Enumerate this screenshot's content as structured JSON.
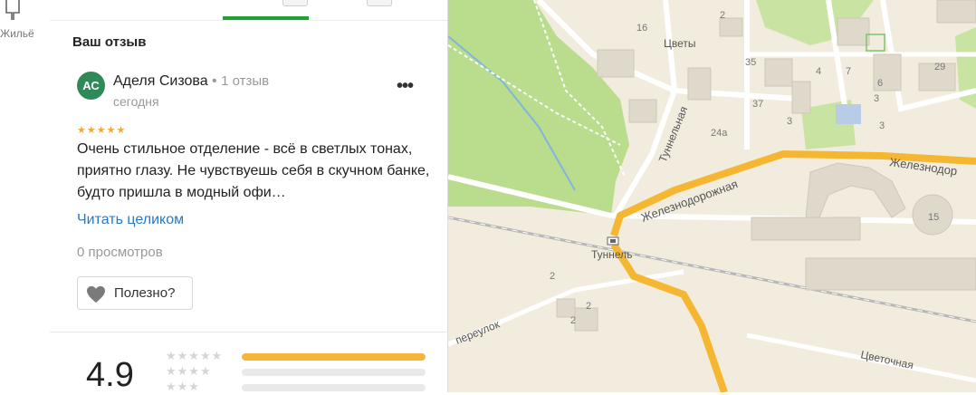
{
  "sidebar": {
    "housing_label": "Жильё",
    "housing_icon": "house-pin-icon"
  },
  "review": {
    "section_title": "Ваш отзыв",
    "avatar_initials": "АС",
    "author_name": "Аделя Сизова",
    "separator": "•",
    "author_reviews": "1 отзыв",
    "date": "сегодня",
    "more_menu": "•••",
    "stars": "★★★★★",
    "rating": 5,
    "text": "Очень стильное отделение - всё в светлых тонах, приятно глазу. Не чувствуешь себя в скучном банке, будто пришла в модный офи…",
    "read_more": "Читать целиком",
    "views": "0 просмотров",
    "helpful_label": "Полезно?",
    "helpful_icon": "heart-icon"
  },
  "summary": {
    "score": "4.9",
    "rows": [
      {
        "stars": "★★★★★",
        "fraction": 1.0
      },
      {
        "stars": "★★★★",
        "fraction": 0.0
      },
      {
        "stars": "★★★",
        "fraction": 0.0
      }
    ]
  },
  "map": {
    "street_labels": [
      "Туннельная",
      "Железнодорожная",
      "Железнодор",
      "переулок",
      "Цветочная",
      "Туннель",
      "Цветы"
    ],
    "house_numbers": [
      "16",
      "2",
      "35",
      "37",
      "3",
      "24а",
      "4",
      "7",
      "6",
      "3",
      "29",
      "15",
      "2",
      "2",
      "2",
      "3"
    ]
  },
  "colors": {
    "accent_green": "#21a038",
    "link_blue": "#2878c8",
    "star_gold": "#f3a83b",
    "bar_fill": "#f6b43a",
    "road_orange": "#f5b731",
    "park_green": "#b9dc8d",
    "map_bg": "#f1ecdd"
  }
}
